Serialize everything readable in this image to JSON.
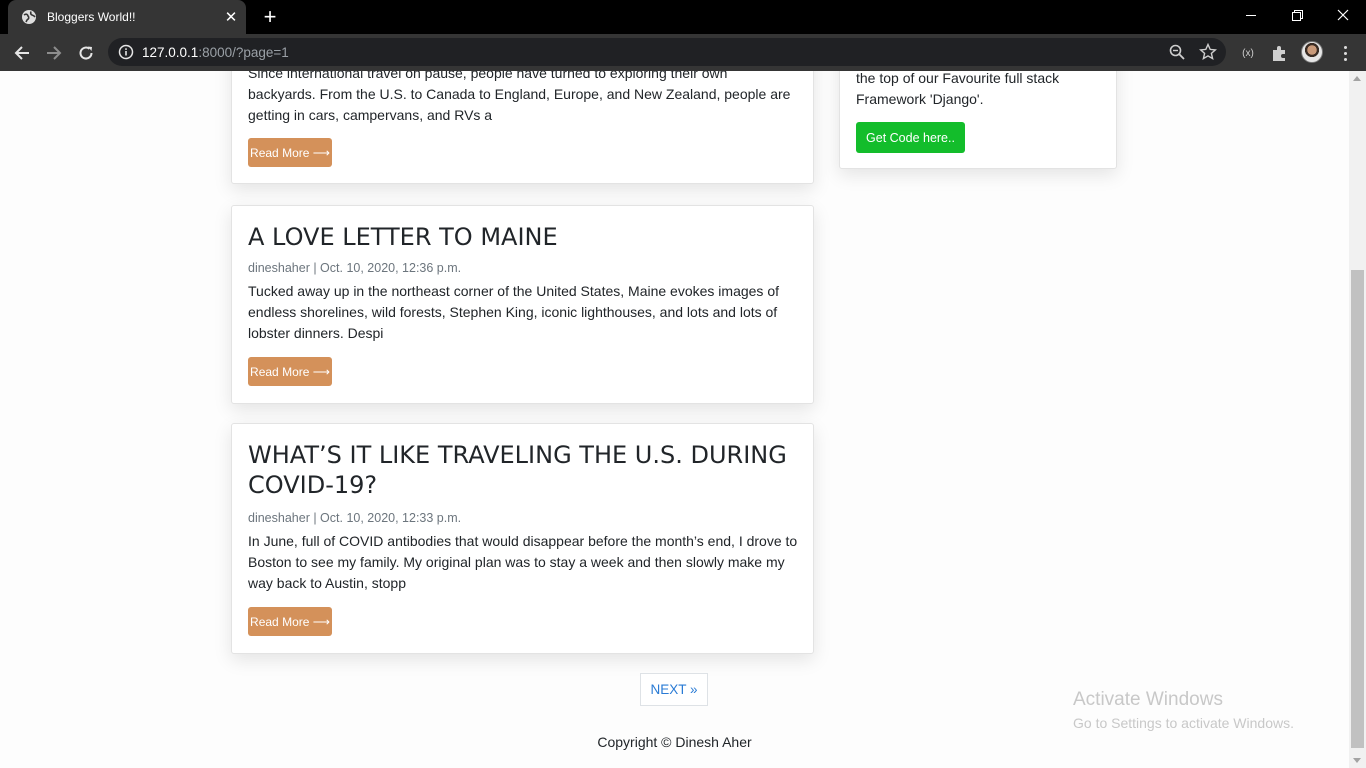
{
  "browser": {
    "tab_title": "Bloggers World!!",
    "url_host": "127.0.0.1",
    "url_rest": ":8000/?page=1"
  },
  "posts": [
    {
      "title": "",
      "meta": "",
      "excerpt": "Since international travel on pause, people have turned to exploring their own backyards. From the U.S. to Canada to England, Europe, and New Zealand, people are getting in cars, campervans, and RVs a",
      "read_more": "Read More ⟶"
    },
    {
      "title": "A LOVE LETTER TO MAINE",
      "meta": "dineshaher | Oct. 10, 2020, 12:36 p.m.",
      "excerpt": "Tucked away up in the northeast corner of the United States, Maine evokes images of endless shorelines, wild forests, Stephen King, iconic lighthouses, and lots and lots of lobster dinners. Despi",
      "read_more": "Read More ⟶"
    },
    {
      "title": "WHAT’S IT LIKE TRAVELING THE U.S. DURING COVID-19?",
      "meta": "dineshaher | Oct. 10, 2020, 12:33 p.m.",
      "excerpt": "In June, full of COVID antibodies that would disappear before the month’s end, I drove to Boston to see my family. My original plan was to stay a week and then slowly make my way back to Austin, stopp",
      "read_more": "Read More ⟶"
    }
  ],
  "sidebar": {
    "text": "the top of our Favourite full stack Framework 'Django'.",
    "button": "Get Code here.."
  },
  "pagination": {
    "next": "NEXT »"
  },
  "footer": {
    "copyright": "Copyright © Dinesh Aher"
  },
  "watermark": {
    "title": "Activate Windows",
    "subtitle": "Go to Settings to activate Windows."
  },
  "colors": {
    "read_more": "#d4915a",
    "get_code": "#13bd2b",
    "link": "#2a7bd5"
  }
}
